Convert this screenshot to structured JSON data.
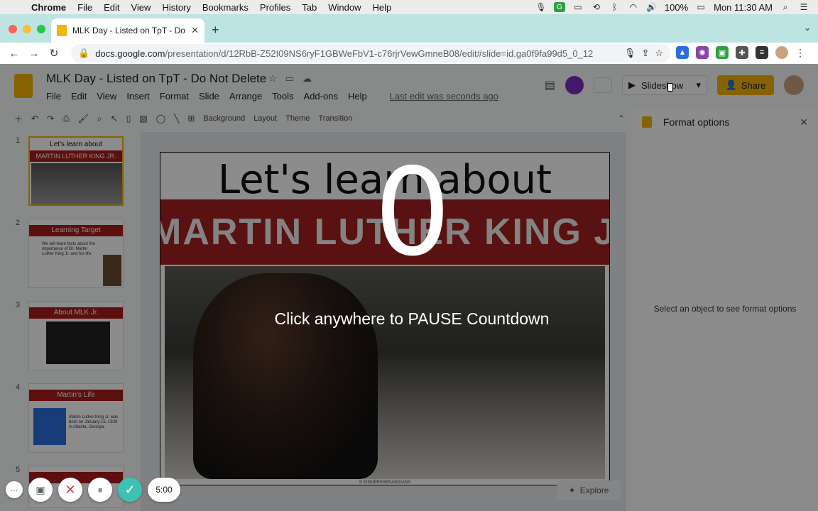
{
  "mac_menu": {
    "apple": "",
    "items": [
      "Chrome",
      "File",
      "Edit",
      "View",
      "History",
      "Bookmarks",
      "Profiles",
      "Tab",
      "Window",
      "Help"
    ],
    "battery": "100%",
    "clock": "Mon 11:30 AM"
  },
  "browser": {
    "tab_title": "MLK Day - Listed on TpT - Do Not Delete - Google Slides",
    "url_host": "docs.google.com",
    "url_path": "/presentation/d/12RbB-Z52I09NS6ryF1GBWeFbV1-c76rjrVewGmneB08/edit#slide=id.ga0f9fa99d5_0_12"
  },
  "doc": {
    "title": "MLK Day - Listed on TpT - Do Not Delete",
    "menus": [
      "File",
      "Edit",
      "View",
      "Insert",
      "Format",
      "Slide",
      "Arrange",
      "Tools",
      "Add-ons",
      "Help"
    ],
    "last_edit": "Last edit was seconds ago",
    "slideshow_label": "Slideshow",
    "share_label": "Share"
  },
  "slide_toolbar": {
    "background": "Background",
    "layout": "Layout",
    "theme": "Theme",
    "transition": "Transition"
  },
  "thumbnails": [
    {
      "num": "1",
      "line1": "Let's learn about",
      "line2": "MARTIN LUTHER KING JR."
    },
    {
      "num": "2",
      "title": "Learning Target",
      "body": "We will learn facts about the importance of Dr. Martin Luther King Jr. and his life."
    },
    {
      "num": "3",
      "title": "About MLK Jr."
    },
    {
      "num": "4",
      "title": "Martin's Life",
      "body": "Martin Luther King Jr. was born on January 15, 1929 in Atlanta, Georgia."
    },
    {
      "num": "5"
    }
  ],
  "slide": {
    "heading": "Let's learn about",
    "band": "MARTIN LUTHER KING JR.",
    "credit": "© KINDERSHENANIGANS"
  },
  "format_panel": {
    "title": "Format options",
    "message": "Select an object to see format options",
    "explore": "Explore"
  },
  "overlay": {
    "countdown": "0",
    "message": "Click anywhere to PAUSE Countdown"
  },
  "recorder": {
    "timer": "5:00"
  }
}
